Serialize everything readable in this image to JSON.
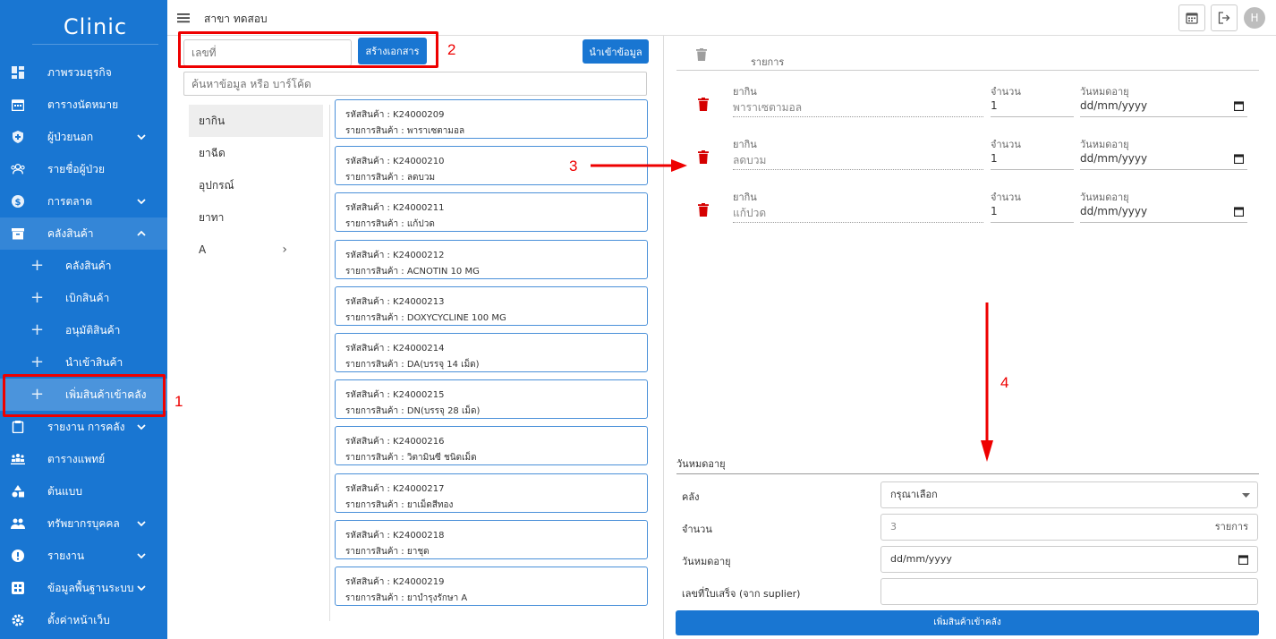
{
  "sidebar": {
    "logo": "Clinic",
    "items": [
      {
        "label": "ภาพรวมธุรกิจ",
        "icon": "dashboard-icon"
      },
      {
        "label": "ตารางนัดหมาย",
        "icon": "calendar-icon"
      },
      {
        "label": "ผู้ป่วยนอก",
        "icon": "shield-icon"
      },
      {
        "label": "รายชื่อผู้ป่วย",
        "icon": "people-icon"
      },
      {
        "label": "การตลาด",
        "icon": "dollar-icon"
      },
      {
        "label": "คลังสินค้า",
        "icon": "archive-icon"
      },
      {
        "label": "คลังสินค้า"
      },
      {
        "label": "เบิกสินค้า"
      },
      {
        "label": "อนุมัติสินค้า"
      },
      {
        "label": "นำเข้าสินค้า"
      },
      {
        "label": "เพิ่มสินค้าเข้าคลัง"
      },
      {
        "label": "รายงาน การคลัง",
        "icon": "clipboard-icon"
      },
      {
        "label": "ตารางแพทย์",
        "icon": "group-icon"
      },
      {
        "label": "ต้นแบบ",
        "icon": "shapes-icon"
      },
      {
        "label": "ทรัพยากรบุคคล",
        "icon": "people-icon"
      },
      {
        "label": "รายงาน",
        "icon": "info-icon"
      },
      {
        "label": "ข้อมูลพื้นฐานระบบ",
        "icon": "grid-icon"
      },
      {
        "label": "ตั้งค่าหน้าเว็บ",
        "icon": "settings-icon"
      }
    ]
  },
  "topbar": {
    "branch": "สาขา ทดสอบ",
    "avatar": "H"
  },
  "left": {
    "doc_placeholder": "เลขที่",
    "create_doc": "สร้างเอกสาร",
    "import_data": "นำเข้าข้อมูล",
    "search_placeholder": "ค้นหาข้อมูล หรือ บาร์โค้ด",
    "categories": [
      "ยากิน",
      "ยาฉีด",
      "อุปกรณ์",
      "ยาทา",
      "A"
    ],
    "products": [
      {
        "code": "รหัสสินค้า : K24000209",
        "name": "รายการสินค้า : พาราเซตามอล"
      },
      {
        "code": "รหัสสินค้า : K24000210",
        "name": "รายการสินค้า : ลดบวม"
      },
      {
        "code": "รหัสสินค้า : K24000211",
        "name": "รายการสินค้า : แก้ปวด"
      },
      {
        "code": "รหัสสินค้า : K24000212",
        "name": "รายการสินค้า : ACNOTIN 10 MG"
      },
      {
        "code": "รหัสสินค้า : K24000213",
        "name": "รายการสินค้า : DOXYCYCLINE 100 MG"
      },
      {
        "code": "รหัสสินค้า : K24000214",
        "name": "รายการสินค้า : DA(บรรจุ 14 เม็ด)"
      },
      {
        "code": "รหัสสินค้า : K24000215",
        "name": "รายการสินค้า : DN(บรรจุ 28 เม็ด)"
      },
      {
        "code": "รหัสสินค้า : K24000216",
        "name": "รายการสินค้า : วิตามินซี ชนิดเม็ด"
      },
      {
        "code": "รหัสสินค้า : K24000217",
        "name": "รายการสินค้า : ยาเม็ดสีทอง"
      },
      {
        "code": "รหัสสินค้า : K24000218",
        "name": "รายการสินค้า : ยาชุด"
      },
      {
        "code": "รหัสสินค้า : K24000219",
        "name": "รายการสินค้า : ยาบำรุงรักษา A"
      }
    ]
  },
  "right": {
    "header": "รายการ",
    "col_item": "ยากิน",
    "col_qty": "จำนวน",
    "col_exp": "วันหมดอายุ",
    "rows": [
      {
        "item": "พาราเซตามอล",
        "qty": "1",
        "exp": "dd/mm/yyyy"
      },
      {
        "item": "ลดบวม",
        "qty": "1",
        "exp": "dd/mm/yyyy"
      },
      {
        "item": "แก้ปวด",
        "qty": "1",
        "exp": "dd/mm/yyyy"
      }
    ],
    "exp_title": "วันหมดอายุ",
    "form": {
      "warehouse_label": "คลัง",
      "warehouse_value": "กรุณาเลือก",
      "qty_label": "จำนวน",
      "qty_value": "3",
      "qty_unit": "รายการ",
      "exp_label": "วันหมดอายุ",
      "exp_value": "dd/mm/yyyy",
      "receipt_label": "เลขที่ใบเสร็จ (จาก suplier)",
      "receipt_value": ""
    },
    "submit": "เพิ่มสินค้าเข้าคลัง"
  },
  "annotations": [
    "1",
    "2",
    "3",
    "4"
  ],
  "colors": {
    "primary": "#1976d2",
    "danger": "#e00000"
  }
}
